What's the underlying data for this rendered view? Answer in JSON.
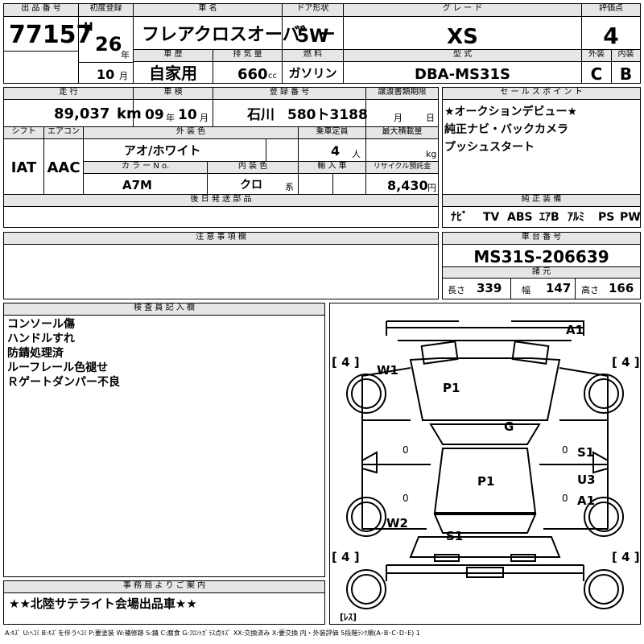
{
  "header": {
    "lot_no_label": "出 品 番 号",
    "lot_no": "77157",
    "first_reg_label": "初度登録",
    "era": "H",
    "year": "26",
    "year_unit": "年",
    "month": "10",
    "month_unit": "月",
    "car_name_label": "車 名",
    "car_name": "フレアクロスオーバ゛ー",
    "door_label": "ドア形状",
    "door": "5W",
    "grade_label": "グ レ ー ド",
    "grade": "XS",
    "score_label": "評価点",
    "score": "4",
    "history_label": "車 歴",
    "history": "自家用",
    "displacement_label": "排 気 量",
    "displacement": "660",
    "displacement_unit": "cc",
    "fuel_label": "燃 料",
    "fuel": "ガソリン",
    "model_label": "型 式",
    "model": "DBA-MS31S",
    "exterior_label": "外装",
    "exterior": "C",
    "interior_label": "内装",
    "interior": "B"
  },
  "row2": {
    "mileage_label": "走 行",
    "mileage": "89,037",
    "mileage_unit": "km",
    "inspection_label": "車 検",
    "insp_year": "09",
    "insp_year_unit": "年",
    "insp_month": "10",
    "insp_month_unit": "月",
    "plate_label": "登 録 番 号",
    "plate_area": "石川",
    "plate_num": "580ト3188",
    "transfer_label": "譲渡書類期限",
    "transfer_month": "月",
    "transfer_day": "日",
    "shift_label": "シフト",
    "shift": "IAT",
    "ac_label": "エアコン",
    "ac": "AAC",
    "color_label": "外 装 色",
    "color": "アオ/ホワイト",
    "capacity_label": "乗車定員",
    "capacity": "4",
    "capacity_unit": "人",
    "load_label": "最大積載量",
    "load_unit": "kg",
    "color_no_label": "カ ラ ー N o.",
    "color_no": "A7M",
    "int_color_label": "内 装 色",
    "int_color": "クロ",
    "int_color_unit": "系",
    "import_label": "輸 入 車",
    "recycle_label": "リサイクル預託金",
    "recycle": "8,430",
    "recycle_unit": "円",
    "later_parts_label": "後 日 発 送 部 品"
  },
  "sales_points": {
    "label": "セ ー ル ス ポ イ ン ト",
    "lines": [
      "★オークションデビュー★",
      "純正ナビ・バックカメラ",
      "プッシュスタート"
    ]
  },
  "equipment": {
    "label": "純 正 装 備",
    "items": [
      "ﾅﾋﾞ",
      "TV",
      "ABS",
      "ｴｱB",
      "ｱﾙﾐ",
      "PS",
      "PW"
    ]
  },
  "caution": {
    "label": "注 意 事 項 欄"
  },
  "chassis": {
    "label": "車 台 番 号",
    "number": "MS31S-206639",
    "dims_label": "諸 元",
    "length_label": "長さ",
    "length": "339",
    "width_label": "幅",
    "width": "147",
    "height_label": "高さ",
    "height": "166"
  },
  "inspector": {
    "label": "検 査 員 記 入 欄",
    "lines": [
      "コンソール傷",
      "ハンドルすれ",
      "防錆処理済",
      "ルーフレール色褪せ",
      "Ｒゲートダンパー不良"
    ]
  },
  "office": {
    "label": "事 務 局 よ り ご 案 内",
    "text": "★★北陸サテライト会場出品車★★"
  },
  "diagram": {
    "tire_fl": "[ 4 ]",
    "tire_fr": "[ 4 ]",
    "tire_rl": "[ 4 ]",
    "tire_rr": "[ 4 ]",
    "spare": "[ﾚｽ]",
    "marks": {
      "a1_top": "A1",
      "w1": "W1",
      "p1_hood": "P1",
      "g": "G",
      "s1_right": "S1",
      "u3": "U3",
      "a1_right": "A1",
      "p1_roof": "P1",
      "w2": "W2",
      "s1_rear": "S1"
    },
    "zero_marks": [
      "0",
      "0",
      "0",
      "0"
    ]
  },
  "legend": "A:ｷｽﾞ U:ﾍｺﾐ B:ｷｽﾞを伴うﾍｺﾐ P:要塗装 W:補修跡 S:錆 C:腐食 G:ﾌﾛﾝﾄｶﾞﾗｽ点ｷｽﾞ XX:交換済み X:要交換 内・外装評価 5段階ﾗﾝｸ順(A･B･C･D･E) 1"
}
